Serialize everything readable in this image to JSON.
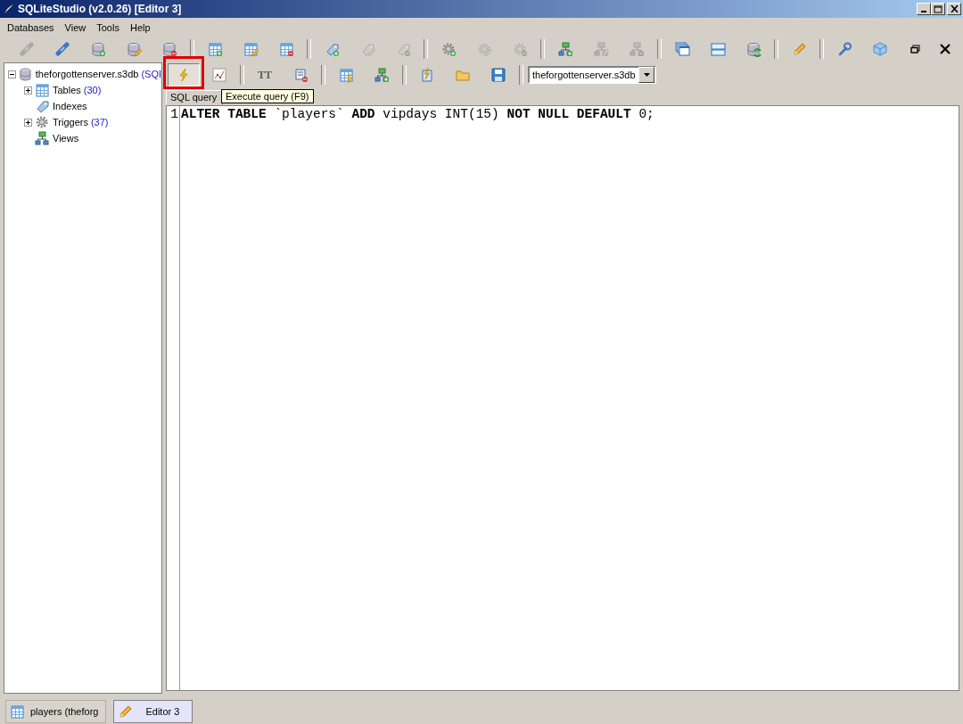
{
  "window": {
    "title": "SQLiteStudio (v2.0.26) [Editor 3]"
  },
  "menu": [
    "Databases",
    "View",
    "Tools",
    "Help"
  ],
  "toolbar": [
    {
      "disabled": true
    },
    {
      "disabled": false
    },
    {
      "disabled": false
    },
    {
      "disabled": false
    },
    {
      "disabled": false
    },
    {
      "disabled": false
    },
    {
      "disabled": false
    },
    {
      "disabled": false
    },
    {
      "disabled": false
    },
    {
      "disabled": true
    },
    {
      "disabled": true
    },
    {
      "disabled": false
    },
    {
      "disabled": true
    },
    {
      "disabled": true
    },
    {
      "disabled": false
    },
    {
      "disabled": true
    },
    {
      "disabled": true
    },
    {
      "disabled": false
    },
    {
      "disabled": false
    },
    {
      "disabled": false
    },
    {
      "disabled": false
    },
    {
      "disabled": false
    },
    {
      "disabled": false
    }
  ],
  "tree": [
    {
      "label": "theforgottenserver.s3db",
      "suffix": "(SQI",
      "expanded": true,
      "children": [
        {
          "label": "Tables",
          "count": "(30)",
          "expanded": false
        },
        {
          "label": "Indexes"
        },
        {
          "label": "Triggers",
          "count": "(37)",
          "expanded": false
        },
        {
          "label": "Views"
        }
      ]
    }
  ],
  "editor_toolbar": [
    {
      "pressed": true,
      "highlight": true
    },
    {
      "pressed": false
    },
    {
      "label": "TT",
      "pressed": false
    },
    {
      "pressed": false
    },
    {
      "pressed": false
    },
    {
      "pressed": false
    },
    {
      "pressed": false
    },
    {
      "pressed": false
    },
    {
      "pressed": false
    }
  ],
  "database_select": {
    "value": "theforgottenserver.s3db"
  },
  "tabs": [
    {
      "label": "SQL query",
      "selected": true
    }
  ],
  "tooltip": "Execute query (F9)",
  "editor": {
    "lines": [
      {
        "number": "1",
        "code": "**ALTER TABLE** `players` **ADD** vipdays INT(15) **NOT NULL DEFAULT** 0;"
      }
    ]
  },
  "taskbar": [
    {
      "label": "players (theforg",
      "selected": false
    },
    {
      "label": "Editor 3",
      "selected": true
    }
  ]
}
